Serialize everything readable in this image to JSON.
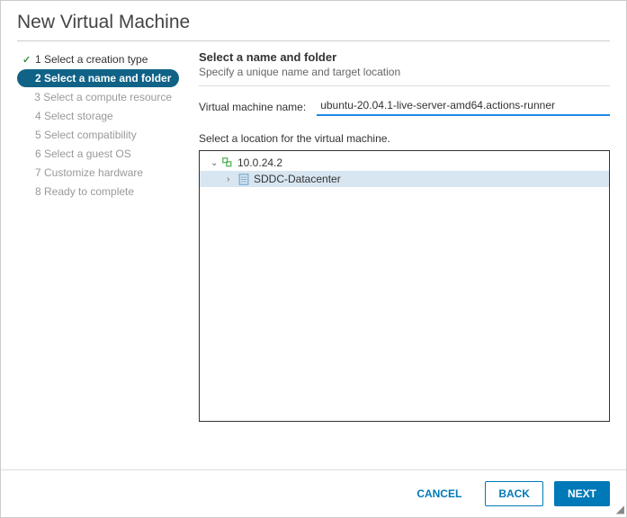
{
  "dialog": {
    "title": "New Virtual Machine"
  },
  "steps": [
    {
      "label": "1 Select a creation type",
      "state": "completed"
    },
    {
      "label": "2 Select a name and folder",
      "state": "current"
    },
    {
      "label": "3 Select a compute resource",
      "state": "future"
    },
    {
      "label": "4 Select storage",
      "state": "future"
    },
    {
      "label": "5 Select compatibility",
      "state": "future"
    },
    {
      "label": "6 Select a guest OS",
      "state": "future"
    },
    {
      "label": "7 Customize hardware",
      "state": "future"
    },
    {
      "label": "8 Ready to complete",
      "state": "future"
    }
  ],
  "panel": {
    "heading": "Select a name and folder",
    "subheading": "Specify a unique name and target location",
    "vm_name_label": "Virtual machine name:",
    "vm_name_value": "ubuntu-20.04.1-live-server-amd64.actions-runner",
    "location_label": "Select a location for the virtual machine."
  },
  "tree": {
    "root": {
      "label": "10.0.24.2",
      "expanded": true
    },
    "child": {
      "label": "SDDC-Datacenter",
      "selected": true,
      "expanded": false
    }
  },
  "footer": {
    "cancel": "CANCEL",
    "back": "BACK",
    "next": "NEXT"
  }
}
